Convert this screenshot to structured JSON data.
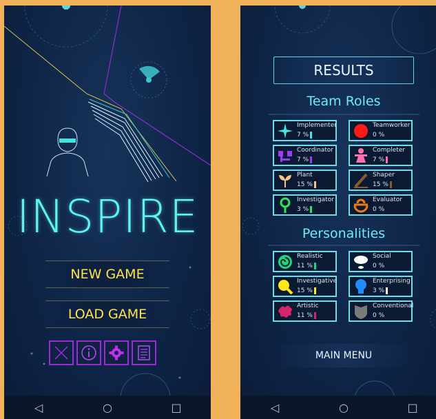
{
  "left": {
    "app_title": "INSPIRE",
    "buttons": {
      "new_game": "NEW GAME",
      "load_game": "LOAD GAME"
    },
    "icon_bar": [
      "close-icon",
      "info-icon",
      "settings-icon",
      "notes-icon"
    ],
    "accent": "#5ff2f0",
    "button_text_color": "#ffe34d"
  },
  "right": {
    "heading": "RESULTS",
    "team_roles_title": "Team Roles",
    "team_roles": [
      {
        "name": "Implementer",
        "value": "7 %",
        "icon": "sparkle-icon",
        "color": "#48e3e6"
      },
      {
        "name": "Teamworker",
        "value": "0 %",
        "icon": "red-circle-icon",
        "color": "#ff1a1a"
      },
      {
        "name": "Coordinator",
        "value": "7 %",
        "icon": "hierarchy-icon",
        "color": "#9b3df0"
      },
      {
        "name": "Completer",
        "value": "7 %",
        "icon": "person-icon",
        "color": "#ff6fae"
      },
      {
        "name": "Plant",
        "value": "15 %",
        "icon": "sprout-icon",
        "color": "#f5c48a"
      },
      {
        "name": "Shaper",
        "value": "15 %",
        "icon": "chisel-icon",
        "color": "#8b5a2b"
      },
      {
        "name": "Investigator",
        "value": "3 %",
        "icon": "magnifier-icon",
        "color": "#35e05c"
      },
      {
        "name": "Evaluator",
        "value": "0 %",
        "icon": "scale-icon",
        "color": "#f07a12"
      }
    ],
    "personalities_title": "Personalities",
    "personalities": [
      {
        "name": "Realistic",
        "value": "11 %",
        "icon": "swirl-icon",
        "color": "#1ed678"
      },
      {
        "name": "Social",
        "value": "0 %",
        "icon": "speech-bubble-icon",
        "color": "#ffffff"
      },
      {
        "name": "Investigative",
        "value": "15 %",
        "icon": "search-icon",
        "color": "#ffe81a"
      },
      {
        "name": "Enterprising",
        "value": "3 %",
        "icon": "lightbulb-icon",
        "color": "#1e8dff"
      },
      {
        "name": "Artistic",
        "value": "11 %",
        "icon": "paint-splash-icon",
        "color": "#d8246a"
      },
      {
        "name": "Conventional",
        "value": "0 %",
        "icon": "shield-icon",
        "color": "#7a7a7a"
      }
    ],
    "main_menu": "MAIN MENU"
  },
  "nav": {
    "back": "◁",
    "home": "○",
    "recents": "□"
  }
}
